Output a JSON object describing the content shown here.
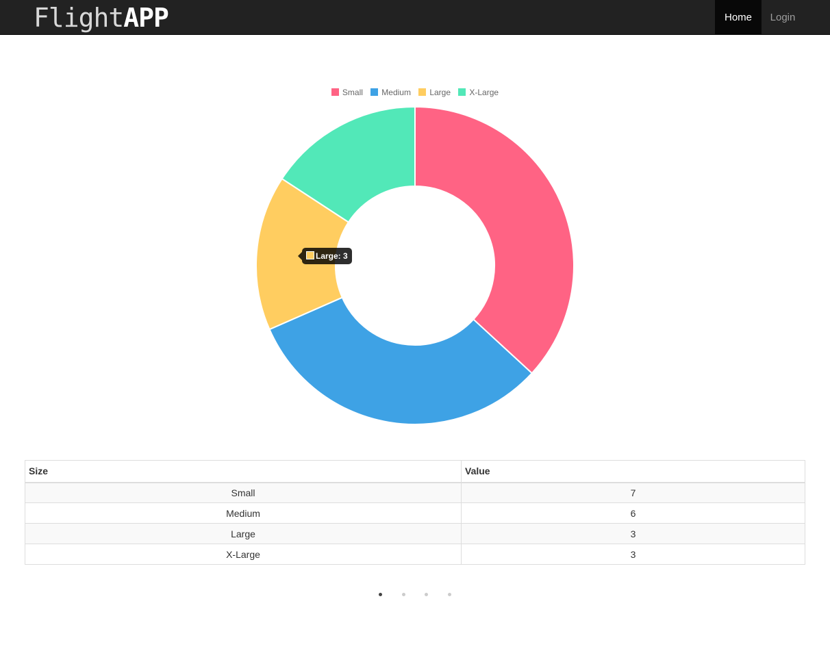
{
  "brand": {
    "part1": "Flight",
    "part2": "APP"
  },
  "nav": {
    "home": "Home",
    "login": "Login"
  },
  "chart_data": {
    "type": "pie",
    "categories": [
      "Small",
      "Medium",
      "Large",
      "X-Large"
    ],
    "values": [
      7,
      6,
      3,
      3
    ],
    "colors": [
      "#ff6384",
      "#3ea2e5",
      "#ffcd60",
      "#52e8b8"
    ],
    "legend_position": "top-center",
    "donut": true,
    "tooltip": {
      "label": "Large: 3",
      "color": "#ffcd60"
    }
  },
  "table": {
    "headers": [
      "Size",
      "Value"
    ],
    "rows": [
      [
        "Small",
        "7"
      ],
      [
        "Medium",
        "6"
      ],
      [
        "Large",
        "3"
      ],
      [
        "X-Large",
        "3"
      ]
    ]
  },
  "carousel": {
    "count": 4,
    "active": 0
  }
}
